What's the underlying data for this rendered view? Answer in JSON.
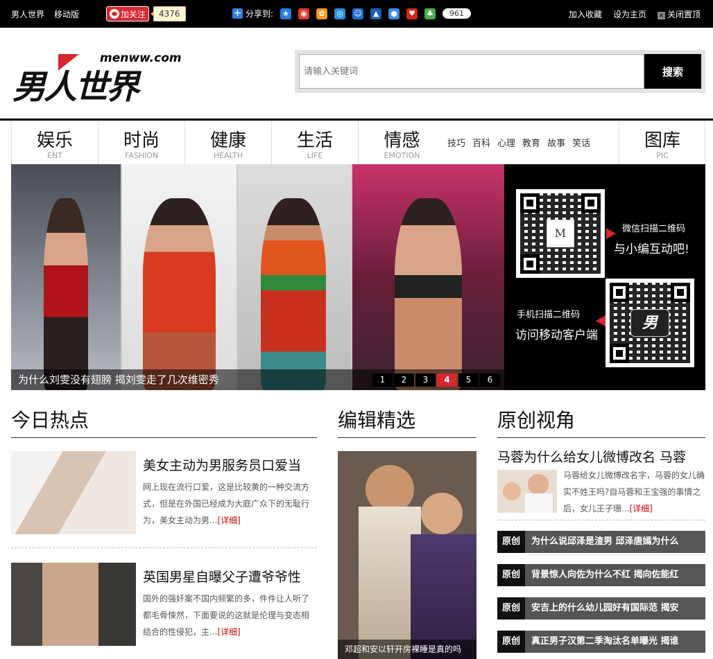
{
  "topbar": {
    "site_name": "男人世界",
    "mobile": "移动版",
    "weibo_follow": "加关注",
    "weibo_count": "4376",
    "share_label": "分享到:",
    "share_count": "961",
    "bookmark": "加入收藏",
    "homepage": "设为主页",
    "close_ad": "关闭置顶"
  },
  "header": {
    "logo_domain": "menww.com",
    "logo_text": "男人世界",
    "search_placeholder": "请输入关键词",
    "search_button": "搜索"
  },
  "nav": {
    "items": [
      {
        "cn": "娱乐",
        "en": "ENT"
      },
      {
        "cn": "时尚",
        "en": "FASHION"
      },
      {
        "cn": "健康",
        "en": "HEALTH"
      },
      {
        "cn": "生活",
        "en": "LIFE"
      },
      {
        "cn": "情感",
        "en": "EMOTION"
      },
      {
        "cn": "图库",
        "en": "PIC"
      }
    ],
    "sub": [
      "技巧",
      "百科",
      "心理",
      "教育",
      "故事",
      "笑话"
    ]
  },
  "banner": {
    "caption": "为什么刘雯没有翅膀 揭刘雯走了几次维密秀",
    "pages": [
      "1",
      "2",
      "3",
      "4",
      "5",
      "6"
    ],
    "active_page": "4"
  },
  "qr": {
    "wechat_line1": "微信扫描二维码",
    "wechat_line2": "与小编互动吧!",
    "mobile_line1": "手机扫描二维码",
    "mobile_line2": "访问移动客户端",
    "wechat_logo": "M",
    "mobile_logo": "男"
  },
  "sections": {
    "hot": "今日热点",
    "editor": "编辑精选",
    "original": "原创视角"
  },
  "hot_news": [
    {
      "title": "美女主动为男服务员口爱当",
      "desc": "网上现在流行口爱，这是比较黄的一种交流方式，但是在外国已经成为大庭广众下的无耻行为，美女主动为男...",
      "more": "[详细]"
    },
    {
      "title": "英国男星自曝父子遭爷爷性",
      "desc": "国外的强奸案不国内频繁的多，件件让人听了都毛骨悚然，下面要说的这就是伦理与变态相结合的性侵犯，主...",
      "more": "[详细]"
    }
  ],
  "editor_pick": {
    "caption": "邓超和安以轩开房裸睡是真的吗"
  },
  "original": {
    "lead_title": "马蓉为什么给女儿微博改名 马蓉",
    "lead_desc": "马蓉给女儿微博改名字，马蓉的女儿确实不姓王吗?自马蓉和王宝强的事情之后，女儿王子珊...",
    "lead_more": "[详细]",
    "tag": "原创",
    "items": [
      "为什么说邱泽是渣男 邱泽唐嫣为什么",
      "背景惊人向佐为什么不红 揭向佐能红",
      "安吉上的什么幼儿园好有国际范 揭安",
      "真正男子汉第二季淘汰名单曝光 揭谁"
    ]
  }
}
